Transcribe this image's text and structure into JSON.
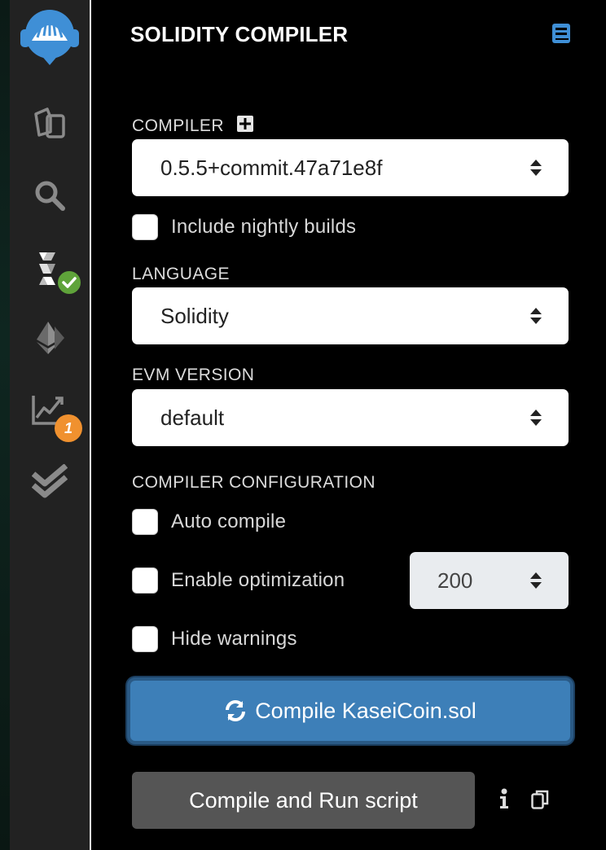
{
  "sidebar": {
    "items": [
      {
        "icon": "remix-logo-icon"
      },
      {
        "icon": "file-explorer-icon"
      },
      {
        "icon": "search-icon"
      },
      {
        "icon": "solidity-compiler-icon",
        "badge_icon": "check-icon"
      },
      {
        "icon": "ethereum-deploy-icon"
      },
      {
        "icon": "analysis-chart-icon",
        "badge": "1"
      },
      {
        "icon": "testing-double-check-icon"
      }
    ],
    "colors": {
      "success": "#5fa33a",
      "warning": "#f0912f"
    }
  },
  "panel": {
    "title": "SOLIDITY COMPILER",
    "compiler": {
      "label": "COMPILER",
      "selected": "0.5.5+commit.47a71e8f",
      "nightly_label": "Include nightly builds"
    },
    "language": {
      "label": "LANGUAGE",
      "selected": "Solidity"
    },
    "evm": {
      "label": "EVM VERSION",
      "selected": "default"
    },
    "config": {
      "label": "COMPILER CONFIGURATION",
      "auto_compile": "Auto compile",
      "optimization": "Enable optimization",
      "runs": "200",
      "hide_warnings": "Hide warnings"
    },
    "compile_button": "Compile KaseiCoin.sol",
    "run_script_button": "Compile and Run script",
    "accent": "#3d7fb8"
  }
}
